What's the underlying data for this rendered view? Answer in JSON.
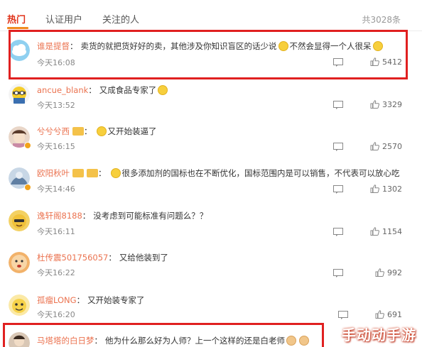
{
  "tabs": [
    {
      "label": "热门"
    },
    {
      "label": "认证用户"
    },
    {
      "label": "关注的人"
    }
  ],
  "total_count": "共3028条",
  "comments": [
    {
      "user": "谁是提督",
      "text_a": "卖货的就把货好好的卖，其他涉及你知识盲区的话少说",
      "text_b": "不然会显得一个人很呆",
      "time": "今天16:08",
      "likes": "5412"
    },
    {
      "user": "ancue_blank",
      "text_a": "又成食品专家了",
      "text_b": "",
      "time": "今天13:52",
      "likes": "3329"
    },
    {
      "user": "兮兮兮西",
      "text_a": "又开始装逼了",
      "text_b": "",
      "time": "今天16:15",
      "likes": "2570"
    },
    {
      "user": "欧阳秋叶",
      "text_a": "很多添加剂的国标也在不断优化，国标范围内是可以销售，不代表可以放心吃",
      "text_b": "",
      "time": "今天14:46",
      "likes": "1302"
    },
    {
      "user": "逸轩阁8188",
      "text_a": "没考虑到可能标准有问题么？？",
      "text_b": "",
      "time": "今天16:11",
      "likes": "1154"
    },
    {
      "user": "杜传震501756057",
      "text_a": "又给他装到了",
      "text_b": "",
      "time": "今天16:22",
      "likes": "992"
    },
    {
      "user": "孤瘤LONG",
      "text_a": "又开始装专家了",
      "text_b": "",
      "time": "今天16:20",
      "likes": "691"
    },
    {
      "user": "马塔塔的白日梦",
      "text_a": "他为什么那么好为人师？上一个这样的还是白老师",
      "text_b": "",
      "time": "",
      "likes": ""
    }
  ],
  "colors": {
    "accent": "#e0331a",
    "username": "#eb7350",
    "highlight": "#e02020"
  },
  "icons": {
    "reply": "comment-icon",
    "like": "thumbs-up-icon"
  },
  "watermark": "手动动手游"
}
